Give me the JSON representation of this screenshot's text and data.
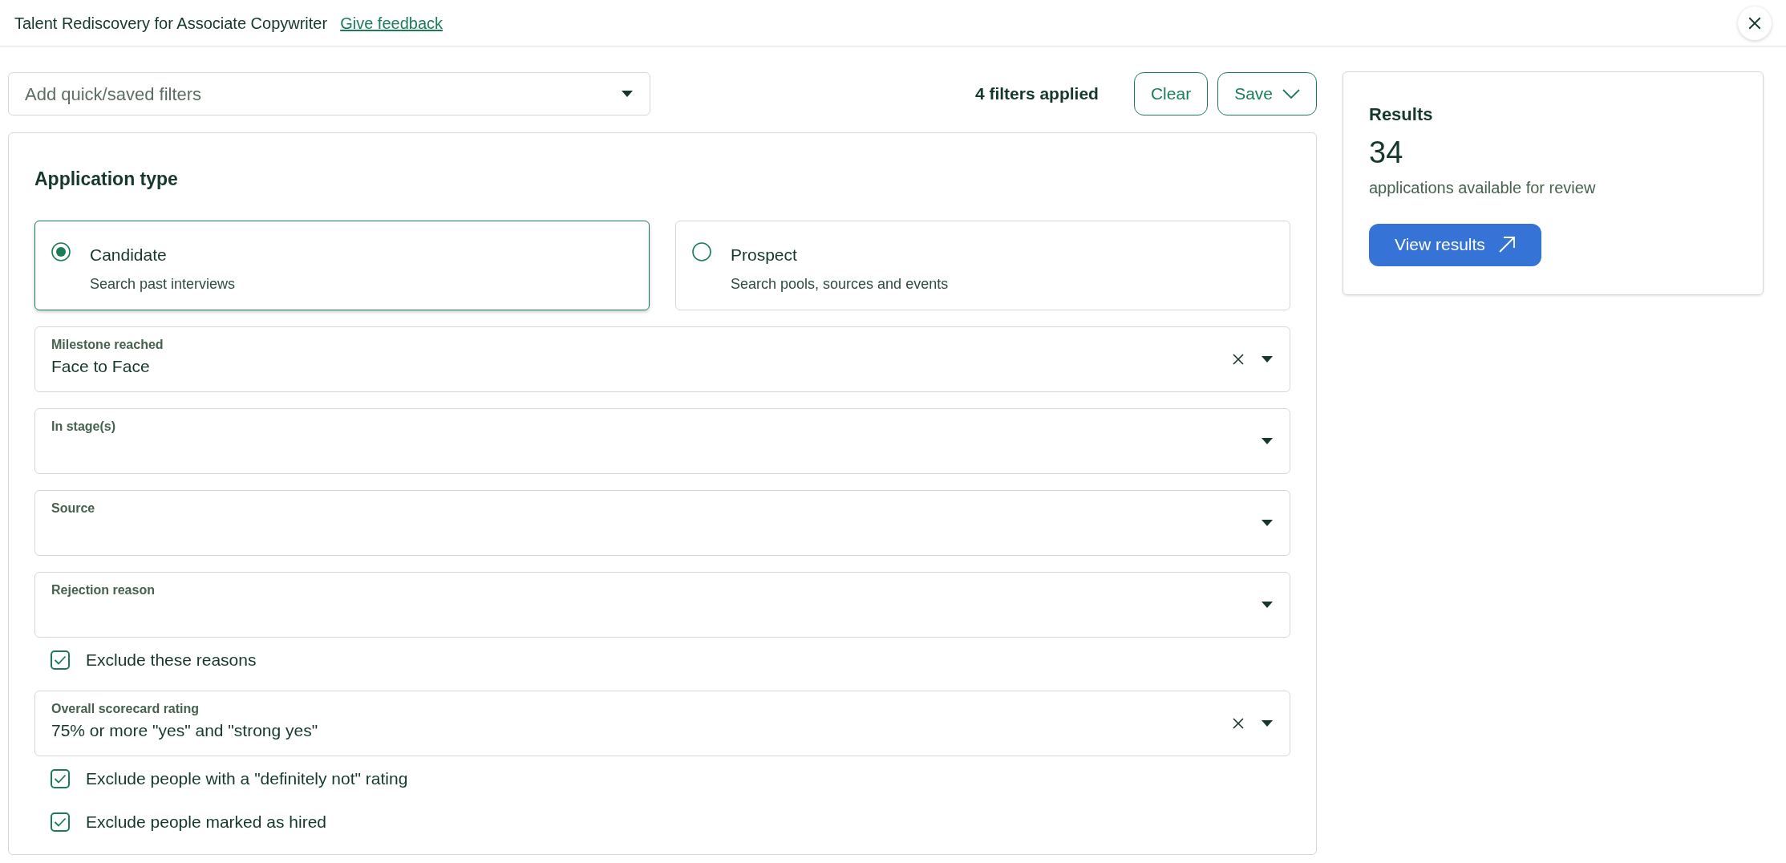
{
  "header": {
    "title": "Talent Rediscovery for Associate Copywriter",
    "feedback_link": "Give feedback"
  },
  "quick_filter": {
    "placeholder": "Add quick/saved filters"
  },
  "filters_applied": "4 filters applied",
  "buttons": [
    "Clear",
    "Save"
  ],
  "application_type": {
    "heading": "Application type",
    "options": [
      {
        "label": "Candidate",
        "description": "Search past interviews",
        "selected": true
      },
      {
        "label": "Prospect",
        "description": "Search pools, sources and events",
        "selected": false
      }
    ]
  },
  "fields": [
    {
      "kind": "select",
      "label": "Milestone reached",
      "value": "Face to Face",
      "clearable": true
    },
    {
      "kind": "select",
      "label": "In stage(s)",
      "clearable": false
    },
    {
      "kind": "select",
      "label": "Source",
      "clearable": false
    },
    {
      "kind": "select",
      "label": "Rejection reason",
      "clearable": false
    },
    {
      "kind": "checkbox",
      "label": "Exclude these reasons",
      "checked": true
    },
    {
      "kind": "select",
      "label": "Overall scorecard rating",
      "value": "75% or more \"yes\" and \"strong yes\"",
      "clearable": true
    },
    {
      "kind": "checkbox",
      "label": "Exclude people with a \"definitely not\" rating",
      "checked": true
    },
    {
      "kind": "checkbox",
      "label": "Exclude people marked as hired",
      "checked": true
    }
  ],
  "results": {
    "heading": "Results",
    "count": "34",
    "caption": "applications available for review",
    "button": "View results"
  }
}
